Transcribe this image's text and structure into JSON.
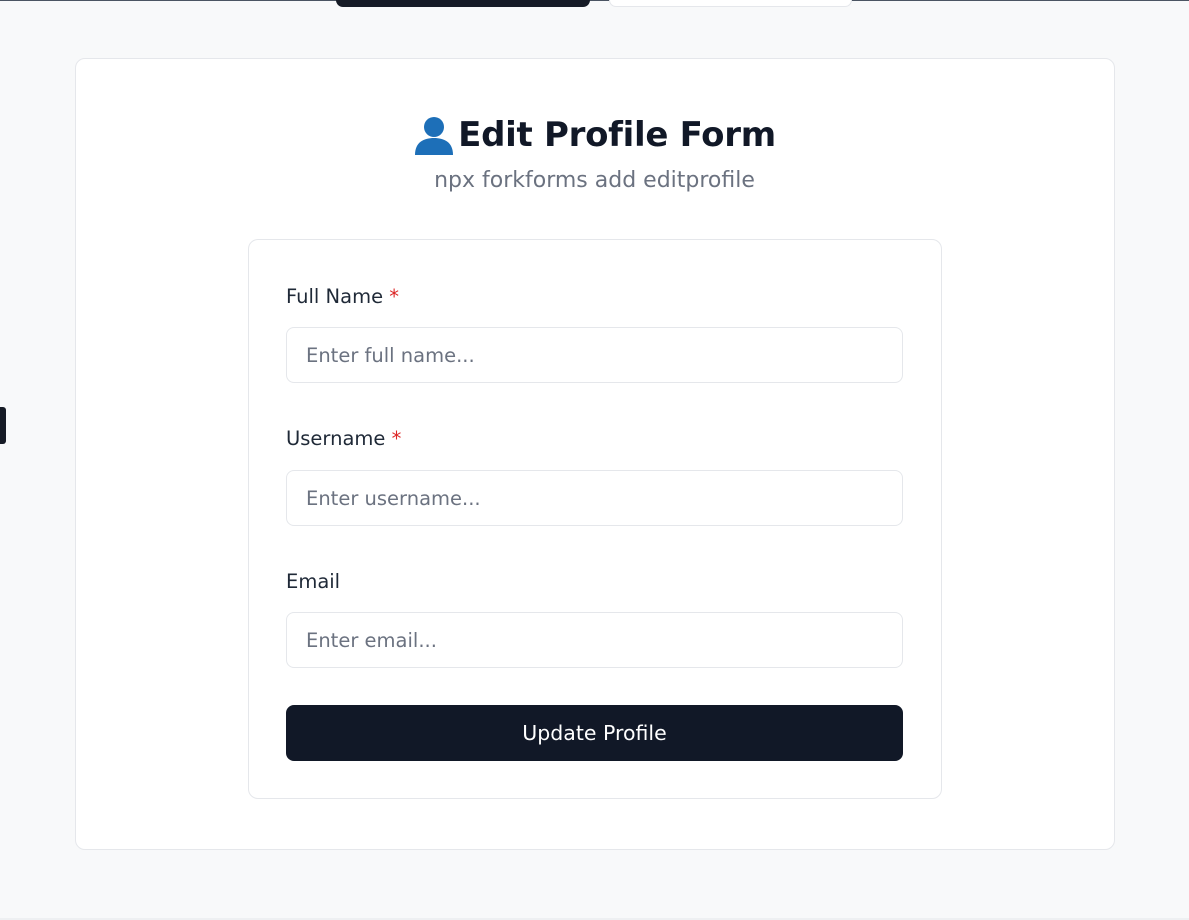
{
  "header": {
    "title": "Edit Profile Form",
    "icon": "user-icon",
    "subtitle": "npx forkforms add editprofile"
  },
  "form": {
    "fields": [
      {
        "label": "Full Name",
        "required_mark": "*",
        "placeholder": "Enter full name...",
        "value": ""
      },
      {
        "label": "Username",
        "required_mark": "*",
        "placeholder": "Enter username...",
        "value": ""
      },
      {
        "label": "Email",
        "required_mark": "",
        "placeholder": "Enter email...",
        "value": ""
      }
    ],
    "submit_label": "Update Profile"
  },
  "colors": {
    "accent": "#111827",
    "required": "#dc2626",
    "icon": "#1d6fb8"
  }
}
